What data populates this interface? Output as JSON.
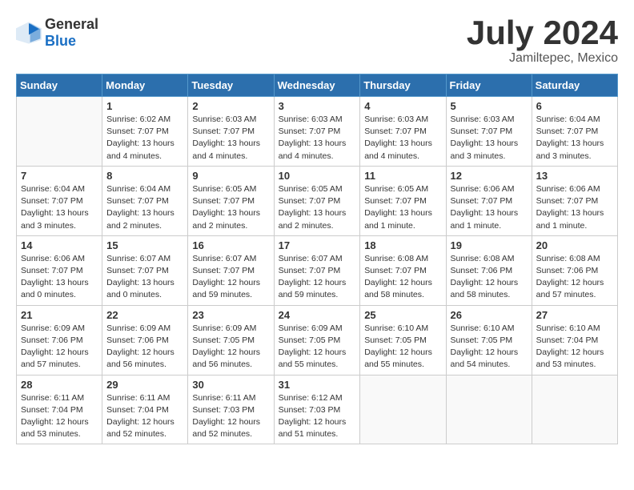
{
  "header": {
    "logo_general": "General",
    "logo_blue": "Blue",
    "month": "July 2024",
    "location": "Jamiltepec, Mexico"
  },
  "weekdays": [
    "Sunday",
    "Monday",
    "Tuesday",
    "Wednesday",
    "Thursday",
    "Friday",
    "Saturday"
  ],
  "weeks": [
    [
      {
        "day": "",
        "info": ""
      },
      {
        "day": "1",
        "info": "Sunrise: 6:02 AM\nSunset: 7:07 PM\nDaylight: 13 hours\nand 4 minutes."
      },
      {
        "day": "2",
        "info": "Sunrise: 6:03 AM\nSunset: 7:07 PM\nDaylight: 13 hours\nand 4 minutes."
      },
      {
        "day": "3",
        "info": "Sunrise: 6:03 AM\nSunset: 7:07 PM\nDaylight: 13 hours\nand 4 minutes."
      },
      {
        "day": "4",
        "info": "Sunrise: 6:03 AM\nSunset: 7:07 PM\nDaylight: 13 hours\nand 4 minutes."
      },
      {
        "day": "5",
        "info": "Sunrise: 6:03 AM\nSunset: 7:07 PM\nDaylight: 13 hours\nand 3 minutes."
      },
      {
        "day": "6",
        "info": "Sunrise: 6:04 AM\nSunset: 7:07 PM\nDaylight: 13 hours\nand 3 minutes."
      }
    ],
    [
      {
        "day": "7",
        "info": "Sunrise: 6:04 AM\nSunset: 7:07 PM\nDaylight: 13 hours\nand 3 minutes."
      },
      {
        "day": "8",
        "info": "Sunrise: 6:04 AM\nSunset: 7:07 PM\nDaylight: 13 hours\nand 2 minutes."
      },
      {
        "day": "9",
        "info": "Sunrise: 6:05 AM\nSunset: 7:07 PM\nDaylight: 13 hours\nand 2 minutes."
      },
      {
        "day": "10",
        "info": "Sunrise: 6:05 AM\nSunset: 7:07 PM\nDaylight: 13 hours\nand 2 minutes."
      },
      {
        "day": "11",
        "info": "Sunrise: 6:05 AM\nSunset: 7:07 PM\nDaylight: 13 hours\nand 1 minute."
      },
      {
        "day": "12",
        "info": "Sunrise: 6:06 AM\nSunset: 7:07 PM\nDaylight: 13 hours\nand 1 minute."
      },
      {
        "day": "13",
        "info": "Sunrise: 6:06 AM\nSunset: 7:07 PM\nDaylight: 13 hours\nand 1 minute."
      }
    ],
    [
      {
        "day": "14",
        "info": "Sunrise: 6:06 AM\nSunset: 7:07 PM\nDaylight: 13 hours\nand 0 minutes."
      },
      {
        "day": "15",
        "info": "Sunrise: 6:07 AM\nSunset: 7:07 PM\nDaylight: 13 hours\nand 0 minutes."
      },
      {
        "day": "16",
        "info": "Sunrise: 6:07 AM\nSunset: 7:07 PM\nDaylight: 12 hours\nand 59 minutes."
      },
      {
        "day": "17",
        "info": "Sunrise: 6:07 AM\nSunset: 7:07 PM\nDaylight: 12 hours\nand 59 minutes."
      },
      {
        "day": "18",
        "info": "Sunrise: 6:08 AM\nSunset: 7:07 PM\nDaylight: 12 hours\nand 58 minutes."
      },
      {
        "day": "19",
        "info": "Sunrise: 6:08 AM\nSunset: 7:06 PM\nDaylight: 12 hours\nand 58 minutes."
      },
      {
        "day": "20",
        "info": "Sunrise: 6:08 AM\nSunset: 7:06 PM\nDaylight: 12 hours\nand 57 minutes."
      }
    ],
    [
      {
        "day": "21",
        "info": "Sunrise: 6:09 AM\nSunset: 7:06 PM\nDaylight: 12 hours\nand 57 minutes."
      },
      {
        "day": "22",
        "info": "Sunrise: 6:09 AM\nSunset: 7:06 PM\nDaylight: 12 hours\nand 56 minutes."
      },
      {
        "day": "23",
        "info": "Sunrise: 6:09 AM\nSunset: 7:05 PM\nDaylight: 12 hours\nand 56 minutes."
      },
      {
        "day": "24",
        "info": "Sunrise: 6:09 AM\nSunset: 7:05 PM\nDaylight: 12 hours\nand 55 minutes."
      },
      {
        "day": "25",
        "info": "Sunrise: 6:10 AM\nSunset: 7:05 PM\nDaylight: 12 hours\nand 55 minutes."
      },
      {
        "day": "26",
        "info": "Sunrise: 6:10 AM\nSunset: 7:05 PM\nDaylight: 12 hours\nand 54 minutes."
      },
      {
        "day": "27",
        "info": "Sunrise: 6:10 AM\nSunset: 7:04 PM\nDaylight: 12 hours\nand 53 minutes."
      }
    ],
    [
      {
        "day": "28",
        "info": "Sunrise: 6:11 AM\nSunset: 7:04 PM\nDaylight: 12 hours\nand 53 minutes."
      },
      {
        "day": "29",
        "info": "Sunrise: 6:11 AM\nSunset: 7:04 PM\nDaylight: 12 hours\nand 52 minutes."
      },
      {
        "day": "30",
        "info": "Sunrise: 6:11 AM\nSunset: 7:03 PM\nDaylight: 12 hours\nand 52 minutes."
      },
      {
        "day": "31",
        "info": "Sunrise: 6:12 AM\nSunset: 7:03 PM\nDaylight: 12 hours\nand 51 minutes."
      },
      {
        "day": "",
        "info": ""
      },
      {
        "day": "",
        "info": ""
      },
      {
        "day": "",
        "info": ""
      }
    ]
  ]
}
